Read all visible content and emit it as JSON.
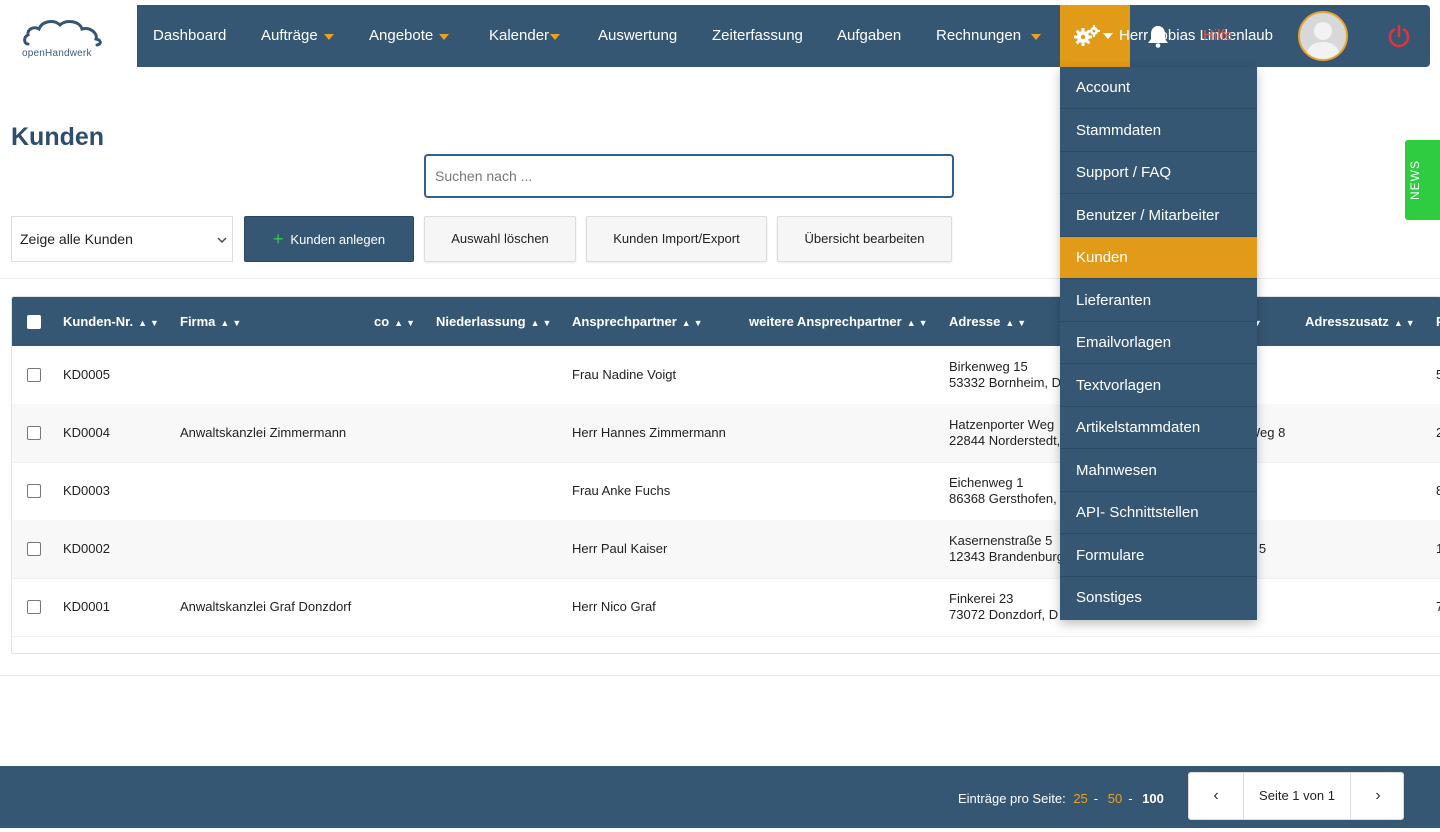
{
  "brand": {
    "logo_text": "openHandwerk"
  },
  "nav": {
    "items": [
      {
        "label": "Dashboard",
        "dropdown": false
      },
      {
        "label": "Aufträge",
        "dropdown": true
      },
      {
        "label": "Angebote",
        "dropdown": true
      },
      {
        "label": "Kalender",
        "dropdown": true
      },
      {
        "label": "Auswertung",
        "dropdown": false
      },
      {
        "label": "Zeiterfassung",
        "dropdown": false
      },
      {
        "label": "Aufgaben",
        "dropdown": false
      },
      {
        "label": "Rechnungen",
        "dropdown": true
      }
    ],
    "user_name": "Herr Tobias Lindenlaub",
    "hilfe_label": "Hilfe"
  },
  "settings_menu": {
    "items": [
      "Account",
      "Stammdaten",
      "Support / FAQ",
      "Benutzer / Mitarbeiter",
      "Kunden",
      "Lieferanten",
      "Emailvorlagen",
      "Textvorlagen",
      "Artikelstammdaten",
      "Mahnwesen",
      "API- Schnittstellen",
      "Formulare",
      "Sonstiges"
    ],
    "active": "Kunden"
  },
  "page": {
    "title": "Kunden",
    "search_placeholder": "Suchen nach ...",
    "filter_selected": "Zeige alle Kunden",
    "buttons": {
      "add": "Kunden anlegen",
      "clear": "Auswahl löschen",
      "import_export": "Kunden Import/Export",
      "edit_overview": "Übersicht bearbeiten"
    }
  },
  "table": {
    "columns": [
      "Kunden-Nr.",
      "Firma",
      "co",
      "Niederlassung",
      "Ansprechpartner",
      "weitere Ansprechpartner",
      "Adresse",
      "",
      "Adresszusatz",
      "P"
    ],
    "rows": [
      {
        "nr": "KD0005",
        "firma": "",
        "ansprechpartner": "Frau Nadine Voigt",
        "adresse1": "Birkenweg 15",
        "adresse2": "53332 Bornheim, D",
        "extra": "",
        "last": "5"
      },
      {
        "nr": "KD0004",
        "firma": "Anwaltskanzlei Zimmermann",
        "ansprechpartner": "Herr Hannes Zimmermann",
        "adresse1": "Hatzenporter Weg",
        "adresse2": "22844 Norderstedt,",
        "extra": "Weg 8",
        "last": "2"
      },
      {
        "nr": "KD0003",
        "firma": "",
        "ansprechpartner": "Frau Anke Fuchs",
        "adresse1": "Eichenweg 1",
        "adresse2": "86368 Gersthofen,",
        "extra": "",
        "last": "8"
      },
      {
        "nr": "KD0002",
        "firma": "",
        "ansprechpartner": "Herr Paul Kaiser",
        "adresse1": "Kasernenstraße 5",
        "adresse2": "12343 Brandenburg",
        "extra": "e 5",
        "last": "1"
      },
      {
        "nr": "KD0001",
        "firma": "Anwaltskanzlei Graf Donzdorf",
        "ansprechpartner": "Herr Nico Graf",
        "adresse1": "Finkerei 23",
        "adresse2": "73072 Donzdorf, D",
        "extra": "",
        "last": "7"
      }
    ]
  },
  "footer": {
    "per_page_label": "Einträge pro Seite:",
    "per_page_options": [
      "25",
      "50",
      "100"
    ],
    "per_page_active": "100",
    "page_info": "Seite 1 von 1",
    "prev": "‹",
    "next": "›"
  },
  "news_label": "NEWS",
  "colors": {
    "primary": "#365773",
    "accent": "#e29a19",
    "news": "#2ecc40",
    "power": "#d9363e"
  }
}
